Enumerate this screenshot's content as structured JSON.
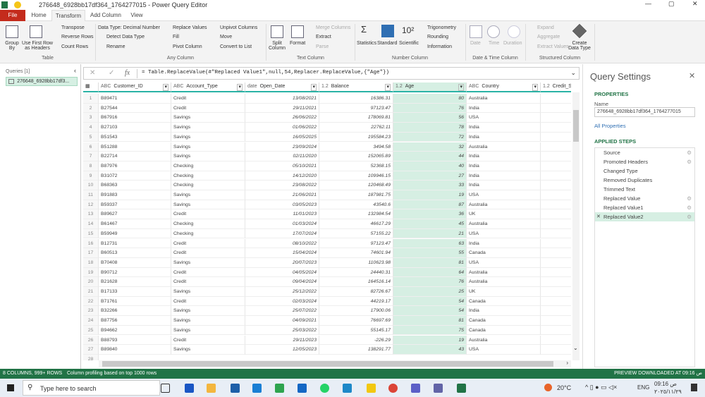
{
  "window": {
    "title": "276648_6928bb17df364_1764277015 - Power Query Editor"
  },
  "tabs": [
    {
      "label": "File"
    },
    {
      "label": "Home"
    },
    {
      "label": "Transform"
    },
    {
      "label": "Add Column"
    },
    {
      "label": "View"
    }
  ],
  "ribbon": {
    "table": {
      "group_label": "Table",
      "group_by": "Group By",
      "use_first_row": "Use First Row as Headers",
      "transpose": "Transpose",
      "reverse_rows": "Reverse Rows",
      "count_rows": "Count Rows"
    },
    "any_column": {
      "group_label": "Any Column",
      "data_type": "Data Type: Decimal Number",
      "detect_data_type": "Detect Data Type",
      "rename": "Rename",
      "replace_values": "Replace Values",
      "fill": "Fill",
      "pivot_column": "Pivot Column",
      "unpivot_columns": "Unpivot Columns",
      "move": "Move",
      "convert_to_list": "Convert to List"
    },
    "text_column": {
      "group_label": "Text Column",
      "split_column": "Split Column",
      "format": "Format",
      "merge_columns": "Merge Columns",
      "extract": "Extract",
      "parse": "Parse"
    },
    "number_column": {
      "group_label": "Number Column",
      "statistics": "Statistics",
      "standard": "Standard",
      "scientific": "Scientific",
      "trigonometry": "Trigonometry",
      "rounding": "Rounding",
      "information": "Information"
    },
    "date_time_column": {
      "group_label": "Date & Time Column",
      "date": "Date",
      "time": "Time",
      "duration": "Duration"
    },
    "structured_column": {
      "group_label": "Structured Column",
      "expand": "Expand",
      "aggregate": "Aggregate",
      "extract_values": "Extract Values",
      "create_data_type": "Create Data Type"
    }
  },
  "queries": {
    "header": "Queries [1]",
    "items": [
      {
        "label": "276648_6928bb17df3..."
      }
    ]
  },
  "formula": {
    "text": "= Table.ReplaceValue(#\"Replaced Value1\",null,54,Replacer.ReplaceValue,{\"Age\"})"
  },
  "table": {
    "columns": [
      {
        "type": "ABC",
        "name": "Customer_ID"
      },
      {
        "type": "ABC",
        "name": "Account_Type"
      },
      {
        "type": "date",
        "name": "Open_Date"
      },
      {
        "type": "1.2",
        "name": "Balance"
      },
      {
        "type": "1.2",
        "name": "Age"
      },
      {
        "type": "ABC",
        "name": "Country"
      },
      {
        "type": "1.2",
        "name": "Credit_Score"
      }
    ],
    "rows": [
      [
        "B89471",
        "Credit",
        "13/08/2021",
        "16386.31",
        "80",
        "Australia"
      ],
      [
        "B27544",
        "Credit",
        "29/11/2021",
        "97123.47",
        "76",
        "India"
      ],
      [
        "B67916",
        "Savings",
        "26/06/2022",
        "178069.81",
        "56",
        "USA"
      ],
      [
        "B27103",
        "Savings",
        "01/06/2022",
        "22762.11",
        "78",
        "India"
      ],
      [
        "B51543",
        "Savings",
        "16/05/2025",
        "195584.23",
        "72",
        "India"
      ],
      [
        "B51288",
        "Savings",
        "23/09/2024",
        "3494.58",
        "32",
        "Australia"
      ],
      [
        "B22714",
        "Savings",
        "02/11/2020",
        "152065.89",
        "44",
        "India"
      ],
      [
        "B87976",
        "Checking",
        "05/10/2021",
        "52368.15",
        "40",
        "India"
      ],
      [
        "B31072",
        "Checking",
        "14/12/2020",
        "109946.15",
        "27",
        "India"
      ],
      [
        "B68363",
        "Checking",
        "23/08/2022",
        "120468.49",
        "33",
        "India"
      ],
      [
        "B91883",
        "Savings",
        "21/06/2021",
        "187981.75",
        "19",
        "USA"
      ],
      [
        "B59337",
        "Savings",
        "03/05/2023",
        "43540.6",
        "87",
        "Australia"
      ],
      [
        "B89627",
        "Credit",
        "11/01/2023",
        "132984.54",
        "36",
        "UK"
      ],
      [
        "B61467",
        "Checking",
        "01/03/2024",
        "46617.29",
        "45",
        "Australia"
      ],
      [
        "B59949",
        "Checking",
        "17/07/2024",
        "57155.22",
        "21",
        "USA"
      ],
      [
        "B12731",
        "Credit",
        "08/10/2022",
        "97123.47",
        "63",
        "India"
      ],
      [
        "B60513",
        "Credit",
        "15/04/2024",
        "74601.94",
        "55",
        "Canada"
      ],
      [
        "B70408",
        "Savings",
        "20/07/2023",
        "110623.98",
        "81",
        "USA"
      ],
      [
        "B90712",
        "Credit",
        "04/05/2024",
        "24440.31",
        "64",
        "Australia"
      ],
      [
        "B21628",
        "Credit",
        "09/04/2024",
        "164516.14",
        "76",
        "Australia"
      ],
      [
        "B17133",
        "Savings",
        "25/12/2022",
        "82726.67",
        "25",
        "UK"
      ],
      [
        "B71761",
        "Credit",
        "02/03/2024",
        "44219.17",
        "54",
        "Canada"
      ],
      [
        "B32266",
        "Savings",
        "25/07/2022",
        "17900.06",
        "54",
        "India"
      ],
      [
        "B87756",
        "Savings",
        "04/09/2021",
        "76697.69",
        "81",
        "Canada"
      ],
      [
        "B94662",
        "Savings",
        "25/03/2022",
        "55145.17",
        "75",
        "Canada"
      ],
      [
        "B88793",
        "Credit",
        "29/11/2023",
        "-226.29",
        "19",
        "Australia"
      ],
      [
        "B89840",
        "Savings",
        "12/05/2023",
        "138291.77",
        "43",
        "USA"
      ]
    ]
  },
  "query_settings": {
    "title": "Query Settings",
    "properties_label": "PROPERTIES",
    "name_label": "Name",
    "name_value": "276648_6928bb17df364_1764277015",
    "all_properties": "All Properties",
    "applied_steps_label": "APPLIED STEPS",
    "steps": [
      {
        "label": "Source",
        "gear": true
      },
      {
        "label": "Promoted Headers",
        "gear": true
      },
      {
        "label": "Changed Type",
        "gear": false
      },
      {
        "label": "Removed Duplicates",
        "gear": false
      },
      {
        "label": "Trimmed Text",
        "gear": false
      },
      {
        "label": "Replaced Value",
        "gear": true
      },
      {
        "label": "Replaced Value1",
        "gear": true
      },
      {
        "label": "Replaced Value2",
        "gear": true,
        "selected": true
      }
    ]
  },
  "status": {
    "left": "8 COLUMNS, 999+ ROWS",
    "profiling": "Column profiling based on top 1000 rows",
    "right": "PREVIEW DOWNLOADED AT 09:16 ص"
  },
  "taskbar": {
    "search_placeholder": "Type here to search",
    "weather": "20°C",
    "lang": "ENG",
    "time": "09:16 ص",
    "date": "٢٠٢٥/١١/٢٩"
  },
  "colors": {
    "accent": "#217346",
    "file_tab": "#c42b1c",
    "age_column": "#d6efe3",
    "header_underline": "#2bb3a6"
  }
}
